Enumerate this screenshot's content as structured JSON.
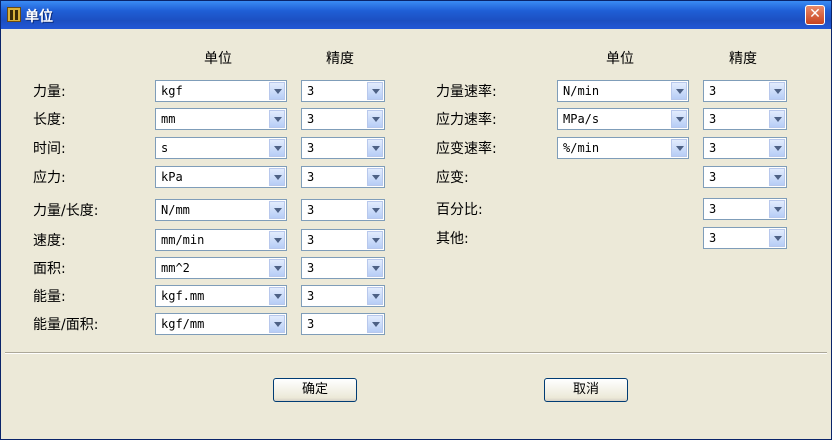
{
  "window": {
    "title": "单位",
    "close_label": "✕"
  },
  "headers": {
    "left_unit": "单位",
    "left_precision": "精度",
    "right_unit": "单位",
    "right_precision": "精度"
  },
  "left_rows": [
    {
      "label": "力量:",
      "unit": "kgf",
      "precision": "3"
    },
    {
      "label": "长度:",
      "unit": "mm",
      "precision": "3"
    },
    {
      "label": "时间:",
      "unit": "s",
      "precision": "3"
    },
    {
      "label": "应力:",
      "unit": "kPa",
      "precision": "3"
    },
    {
      "label": "力量/长度:",
      "unit": "N/mm",
      "precision": "3"
    },
    {
      "label": "速度:",
      "unit": "mm/min",
      "precision": "3"
    },
    {
      "label": "面积:",
      "unit": "mm^2",
      "precision": "3"
    },
    {
      "label": "能量:",
      "unit": "kgf.mm",
      "precision": "3"
    },
    {
      "label": "能量/面积:",
      "unit": "kgf/mm",
      "precision": "3"
    }
  ],
  "right_rows": [
    {
      "label": "力量速率:",
      "unit": "N/min",
      "precision": "3"
    },
    {
      "label": "应力速率:",
      "unit": "MPa/s",
      "precision": "3"
    },
    {
      "label": "应变速率:",
      "unit": "%/min",
      "precision": "3"
    },
    {
      "label": "应变:",
      "precision": "3"
    },
    {
      "label": "百分比:",
      "precision": "3"
    },
    {
      "label": "其他:",
      "precision": "3"
    }
  ],
  "buttons": {
    "ok": "确定",
    "cancel": "取消"
  }
}
